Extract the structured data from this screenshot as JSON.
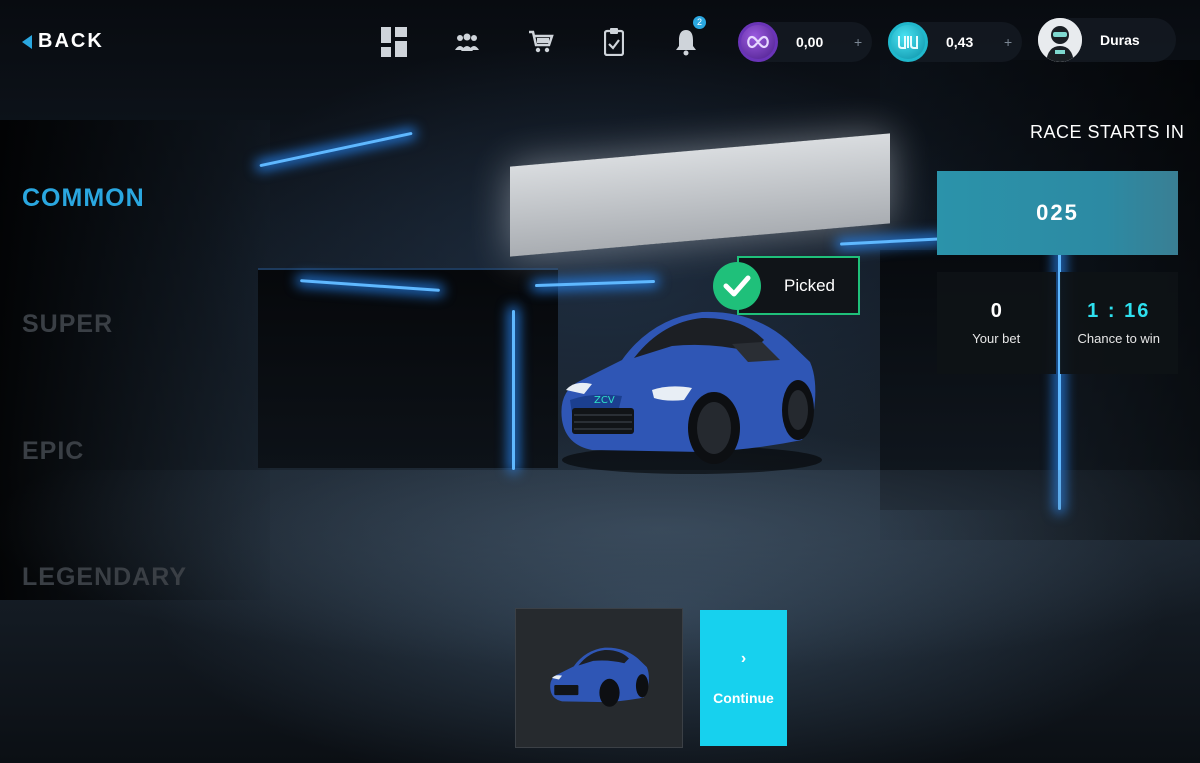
{
  "header": {
    "back_label": "BACK",
    "nav_icons": [
      "dashboard-icon",
      "users-icon",
      "cart-icon",
      "clipboard-icon",
      "bell-icon"
    ],
    "notification_count": "2"
  },
  "wallets": [
    {
      "coin": "purple-coin",
      "amount": "0,00",
      "plus": "+"
    },
    {
      "coin": "teal-coin",
      "amount": "0,43",
      "plus": "+"
    }
  ],
  "user": {
    "name": "Duras"
  },
  "rarity_menu": {
    "items": [
      {
        "label": "COMMON",
        "active": true
      },
      {
        "label": "SUPER",
        "active": false
      },
      {
        "label": "EPIC",
        "active": false
      },
      {
        "label": "LEGENDARY",
        "active": false
      }
    ]
  },
  "race": {
    "title": "RACE STARTS IN",
    "countdown": "025",
    "your_bet_value": "0",
    "your_bet_label": "Your bet",
    "chance_value": "1 : 16",
    "chance_label": "Chance to win"
  },
  "selection": {
    "picked_label": "Picked",
    "continue_chevron": "›",
    "continue_label": "Continue"
  },
  "colors": {
    "accent_blue": "#2aa7e0",
    "teal": "#17d1ee",
    "picked_green": "#1fc07a",
    "car_blue": "#2f56b5"
  }
}
